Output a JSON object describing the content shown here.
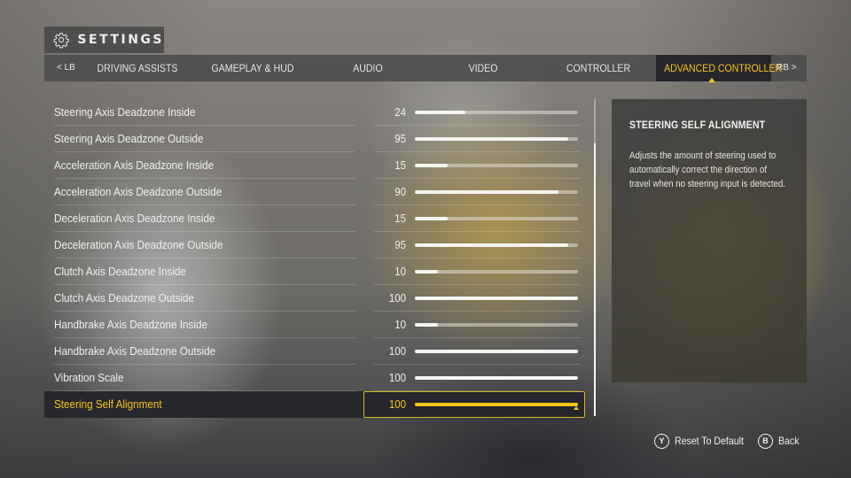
{
  "header": {
    "icon": "gear-icon",
    "title": "SETTINGS"
  },
  "tabs": {
    "prev_bumper": "< LB",
    "next_bumper": "RB >",
    "items": [
      {
        "label": "DRIVING ASSISTS",
        "active": false
      },
      {
        "label": "GAMEPLAY & HUD",
        "active": false
      },
      {
        "label": "AUDIO",
        "active": false
      },
      {
        "label": "VIDEO",
        "active": false
      },
      {
        "label": "CONTROLLER",
        "active": false
      },
      {
        "label": "ADVANCED CONTROLLER",
        "active": true
      }
    ]
  },
  "settings": [
    {
      "label": "Steering Axis Deadzone Inside",
      "value": "24",
      "fill": 0.31
    },
    {
      "label": "Steering Axis Deadzone Outside",
      "value": "95",
      "fill": 0.94
    },
    {
      "label": "Acceleration Axis Deadzone Inside",
      "value": "15",
      "fill": 0.2
    },
    {
      "label": "Acceleration Axis Deadzone Outside",
      "value": "90",
      "fill": 0.88
    },
    {
      "label": "Deceleration Axis Deadzone Inside",
      "value": "15",
      "fill": 0.2
    },
    {
      "label": "Deceleration Axis Deadzone Outside",
      "value": "95",
      "fill": 0.94
    },
    {
      "label": "Clutch Axis Deadzone Inside",
      "value": "10",
      "fill": 0.14
    },
    {
      "label": "Clutch Axis Deadzone Outside",
      "value": "100",
      "fill": 1.0
    },
    {
      "label": "Handbrake Axis Deadzone Inside",
      "value": "10",
      "fill": 0.14
    },
    {
      "label": "Handbrake Axis Deadzone Outside",
      "value": "100",
      "fill": 1.0
    },
    {
      "label": "Vibration Scale",
      "value": "100",
      "fill": 1.0
    },
    {
      "label": "Steering Self Alignment",
      "value": "100",
      "fill": 1.0,
      "selected": true
    }
  ],
  "scrollbar": {
    "thumb_start": 0.14,
    "thumb_end": 1.0
  },
  "description": {
    "title": "STEERING SELF ALIGNMENT",
    "body": "Adjusts the amount of steering used to automatically correct the direction of travel when no steering input is detected."
  },
  "footer": {
    "reset": {
      "glyph": "Y",
      "label": "Reset To Default"
    },
    "back": {
      "glyph": "B",
      "label": "Back"
    }
  },
  "colors": {
    "accent": "#f5c518",
    "selected_row_bg": "#25272d"
  }
}
